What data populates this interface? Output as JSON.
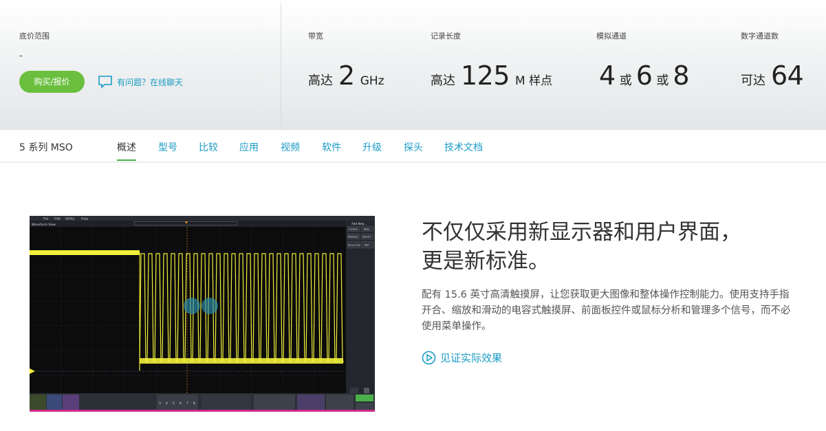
{
  "header": {
    "price_label": "底价范围",
    "price_value": "-",
    "buy_button": "购买/报价",
    "chat_link": "有问题？在线聊天",
    "specs": [
      {
        "label": "带宽",
        "prefix": "高达",
        "value": "2",
        "unit": "GHz"
      },
      {
        "label": "记录长度",
        "prefix": "高达",
        "value": "125",
        "unit": "M 样点"
      },
      {
        "label": "模拟通道",
        "v1": "4",
        "or1": "或",
        "v2": "6",
        "or2": "或",
        "v3": "8"
      },
      {
        "label": "数字通道数",
        "prefix": "可达",
        "value": "64"
      }
    ]
  },
  "nav": {
    "product": "5 系列 MSO",
    "tabs": [
      "概述",
      "型号",
      "比较",
      "应用",
      "视频",
      "软件",
      "升级",
      "探头",
      "技术文档"
    ],
    "active_tab": "概述"
  },
  "feature": {
    "headline_line1": "不仅仅采用新显示器和用户界面，",
    "headline_line2": "更是新标准。",
    "body": "配有 15.6 英寸高清触摸屏，让您获取更大图像和整体操作控制能力。使用支持手指开合、缩放和滑动的电容式触摸屏、前面板控件或鼠标分析和管理多个信号，而不必使用菜单操作。",
    "video_link": "见证实际效果"
  },
  "scope_screen": {
    "menu": [
      "File",
      "Edit",
      "Utility",
      "Help"
    ],
    "panel_title": "Waveform View",
    "side_title": "Add New...",
    "side_buttons": [
      "Cursors",
      "Note",
      "Measure",
      "Search",
      "Results Table",
      "Plot"
    ],
    "channel_numbers": [
      "3",
      "4",
      "5",
      "6",
      "7",
      "8"
    ]
  },
  "colors": {
    "accent_green": "#6bbf3e",
    "link_blue": "#1a9bc5",
    "trace_yellow": "#f2f03a"
  }
}
